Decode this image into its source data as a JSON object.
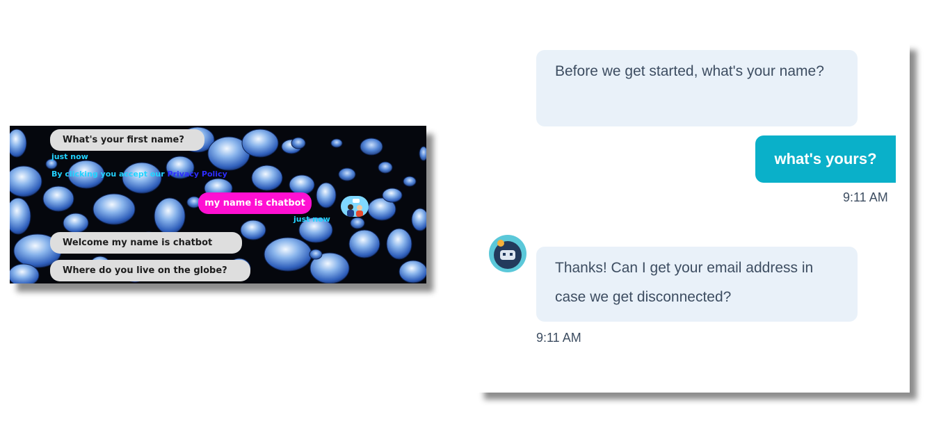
{
  "left_chat": {
    "messages": {
      "first_name_question": "What's your first name?",
      "timestamp_1": "just now",
      "privacy_prefix": "By clicking you accept our ",
      "privacy_link": "Privacy Policy",
      "user_reply": "my name is chatbot",
      "timestamp_2": "just now",
      "welcome": "Welcome my name is chatbot",
      "location_question": "Where do you live on the globe?"
    },
    "colors": {
      "user_bubble": "#ff10d2",
      "timestamp": "#22d3ff",
      "link": "#2d2dff"
    }
  },
  "right_chat": {
    "bot_message_1": "Before we get started, what's your name?",
    "user_message": "what's yours?",
    "user_time": "9:11 AM",
    "bot_message_2": "Thanks! Can I get your email address in case we get disconnected?",
    "bot_time": "9:11 AM",
    "colors": {
      "bot_bubble": "#e9f1f9",
      "user_bubble": "#0ab0c9",
      "text": "#3d4d61"
    }
  }
}
